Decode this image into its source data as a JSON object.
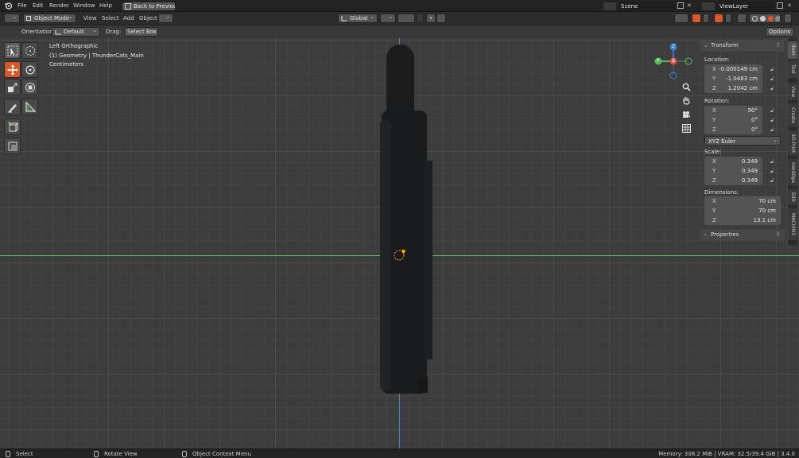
{
  "topbar": {
    "menus": [
      "File",
      "Edit",
      "Render",
      "Window",
      "Help"
    ],
    "back_button": "Back to Previous",
    "scene": "Scene",
    "view_layer": "ViewLayer"
  },
  "header": {
    "mode": "Object Mode",
    "menus": [
      "View",
      "Select",
      "Add",
      "Object"
    ],
    "orientation_select": "Global"
  },
  "tool_header": {
    "orientation_label": "Orientation:",
    "orientation_value": "Default",
    "drag_label": "Drag:",
    "drag_value": "Select Box",
    "options": "Options"
  },
  "viewport": {
    "view_name": "Left Orthographic",
    "object_info": "(1) Geometry | ThunderCats_Main",
    "units": "Centimeters"
  },
  "gizmo": {
    "z": "Z",
    "y": "Y",
    "x": "X"
  },
  "npanel": {
    "transform_title": "Transform",
    "location_label": "Location:",
    "location": [
      {
        "axis": "X",
        "value": "-0.000149 cm"
      },
      {
        "axis": "Y",
        "value": "-1.0483 cm"
      },
      {
        "axis": "Z",
        "value": "1.2042 cm"
      }
    ],
    "rotation_label": "Rotation:",
    "rotation": [
      {
        "axis": "X",
        "value": "90°"
      },
      {
        "axis": "Y",
        "value": "0°"
      },
      {
        "axis": "Z",
        "value": "0°"
      }
    ],
    "rotation_mode": "XYZ Euler",
    "scale_label": "Scale:",
    "scale": [
      {
        "axis": "X",
        "value": "0.349"
      },
      {
        "axis": "Y",
        "value": "0.349"
      },
      {
        "axis": "Z",
        "value": "0.349"
      }
    ],
    "dimensions_label": "Dimensions:",
    "dimensions": [
      {
        "axis": "X",
        "value": "70 cm"
      },
      {
        "axis": "Y",
        "value": "70 cm"
      },
      {
        "axis": "Z",
        "value": "13.1 cm"
      }
    ],
    "properties_title": "Properties"
  },
  "side_tabs": [
    "Item",
    "Tool",
    "View",
    "Create",
    "3D-Print",
    "HardOps",
    "Edit",
    "MACHIN3"
  ],
  "status": {
    "select": "Select",
    "rotate": "Rotate View",
    "context": "Object Context Menu",
    "memory": "Memory: 308.2 MiB | VRAM: 32.5/39.4 GiB | 3.4.0"
  },
  "colors": {
    "accent": "#d45a2c",
    "x_axis": "#e0474f",
    "y_axis": "#5bb85b",
    "z_axis": "#3b7fd1",
    "origin": "#ffaa00"
  }
}
